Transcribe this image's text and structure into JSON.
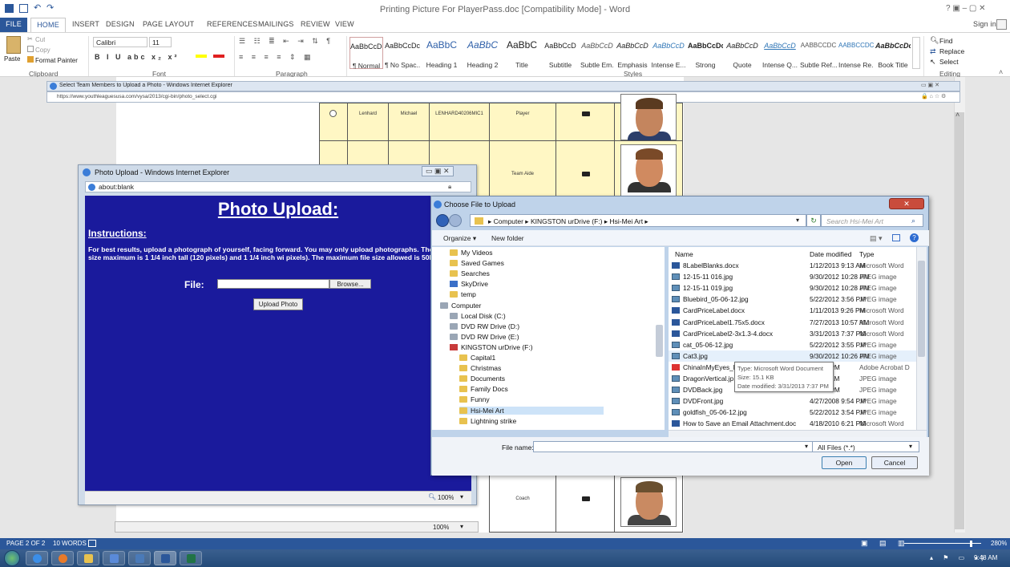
{
  "word": {
    "title": "Printing Picture For PlayerPass.doc [Compatibility Mode] - Word",
    "window_controls": "?   ▣  –  ▢  ✕",
    "sign_in": "Sign in",
    "tabs": [
      "FILE",
      "HOME",
      "INSERT",
      "DESIGN",
      "PAGE LAYOUT",
      "REFERENCES",
      "MAILINGS",
      "REVIEW",
      "VIEW"
    ],
    "clipboard": {
      "paste": "Paste",
      "cut": "Cut",
      "copy": "Copy",
      "format_painter": "Format Painter",
      "group": "Clipboard"
    },
    "font": {
      "name": "Calibri",
      "size": "11",
      "group": "Font"
    },
    "paragraph_group": "Paragraph",
    "styles_group": "Styles",
    "editing": {
      "find": "Find",
      "replace": "Replace",
      "select": "Select",
      "group": "Editing"
    },
    "styles": [
      {
        "sample": "AaBbCcDc",
        "name": "¶ Normal"
      },
      {
        "sample": "AaBbCcDc",
        "name": "¶ No Spac..."
      },
      {
        "sample": "AaBbC",
        "name": "Heading 1"
      },
      {
        "sample": "AaBbC",
        "name": "Heading 2"
      },
      {
        "sample": "AaBbC",
        "name": "Title"
      },
      {
        "sample": "AaBbCcD",
        "name": "Subtitle"
      },
      {
        "sample": "AaBbCcD",
        "name": "Subtle Em..."
      },
      {
        "sample": "AaBbCcD",
        "name": "Emphasis"
      },
      {
        "sample": "AaBbCcD",
        "name": "Intense E..."
      },
      {
        "sample": "AaBbCcDc",
        "name": "Strong"
      },
      {
        "sample": "AaBbCcD",
        "name": "Quote"
      },
      {
        "sample": "AaBbCcD",
        "name": "Intense Q..."
      },
      {
        "sample": "AABBCCDC",
        "name": "Subtle Ref..."
      },
      {
        "sample": "AABBCCDC",
        "name": "Intense Re..."
      },
      {
        "sample": "AaBbCcDc",
        "name": "Book Title"
      }
    ],
    "status": {
      "page": "PAGE 2 OF 2",
      "words": "10 WORDS",
      "zoom": "280%"
    }
  },
  "ie_background": {
    "title": "Select Team Members to Upload a Photo - Windows Internet Explorer",
    "url": "https://www.youthleaguesusa.com/vysa/2013/cgi-bin/photo_select.cgi"
  },
  "team_table": {
    "rows": [
      {
        "last": "Lenhard",
        "first": "Michael",
        "id": "LENHARD40206MIC1",
        "role": "Player"
      },
      {
        "last": "",
        "first": "",
        "id": "",
        "role": "Team Aide"
      },
      {
        "last": "",
        "first": "",
        "id": "",
        "role": "Coach"
      }
    ]
  },
  "photo_upload": {
    "window_title": "Photo Upload - Windows Internet Explorer",
    "address": "about:blank",
    "heading": "Photo Upload:",
    "instructions_heading": "Instructions:",
    "instructions": "For best results, upload a photograph of yourself, facing forward. You may only upload photographs. The photo size maximum is 1 1/4 inch tall (120 pixels) and 1 1/4 inch wi pixels). The maximum file size allowed is 50KB.",
    "file_label": "File:",
    "browse_label": "Browse...",
    "upload_label": "Upload Photo",
    "zoom": "100%"
  },
  "ie2_zoom": "100%",
  "choose_file": {
    "title": "Choose File to Upload",
    "breadcrumb": "▸ Computer ▸ KINGSTON urDrive (F:) ▸ Hsi-Mei Art ▸",
    "search_placeholder": "Search Hsi-Mei Art",
    "organize": "Organize ▾",
    "new_folder": "New folder",
    "columns": {
      "name": "Name",
      "date": "Date modified",
      "type": "Type"
    },
    "tree": [
      {
        "label": "My Videos",
        "kind": "folder",
        "indent": 1
      },
      {
        "label": "Saved Games",
        "kind": "folder",
        "indent": 1
      },
      {
        "label": "Searches",
        "kind": "folder",
        "indent": 1
      },
      {
        "label": "SkyDrive",
        "kind": "blue",
        "indent": 1
      },
      {
        "label": "temp",
        "kind": "folder",
        "indent": 1
      },
      {
        "label": "Computer",
        "kind": "drive",
        "indent": 0
      },
      {
        "label": "Local Disk (C:)",
        "kind": "drive",
        "indent": 1
      },
      {
        "label": "DVD RW Drive (D:)",
        "kind": "drive",
        "indent": 1
      },
      {
        "label": "DVD RW Drive (E:)",
        "kind": "drive",
        "indent": 1
      },
      {
        "label": "KINGSTON urDrive (F:)",
        "kind": "red",
        "indent": 1
      },
      {
        "label": "Capital1",
        "kind": "folder",
        "indent": 2
      },
      {
        "label": "Christmas",
        "kind": "folder",
        "indent": 2
      },
      {
        "label": "Documents",
        "kind": "folder",
        "indent": 2
      },
      {
        "label": "Family Docs",
        "kind": "folder",
        "indent": 2
      },
      {
        "label": "Funny",
        "kind": "folder",
        "indent": 2
      },
      {
        "label": "Hsi-Mei Art",
        "kind": "folder",
        "indent": 2,
        "selected": true
      },
      {
        "label": "Lightning strike",
        "kind": "folder",
        "indent": 2
      }
    ],
    "files": [
      {
        "name": "8LabelBlanks.docx",
        "date": "1/12/2013 9:13 AM",
        "type": "Microsoft Word",
        "icon": "word"
      },
      {
        "name": "12-15-11 016.jpg",
        "date": "9/30/2012 10:28 PM",
        "type": "JPEG image",
        "icon": "img"
      },
      {
        "name": "12-15-11 019.jpg",
        "date": "9/30/2012 10:28 PM",
        "type": "JPEG image",
        "icon": "img"
      },
      {
        "name": "Bluebird_05-06-12.jpg",
        "date": "5/22/2012 3:56 PM",
        "type": "JPEG image",
        "icon": "img"
      },
      {
        "name": "CardPriceLabel.docx",
        "date": "1/11/2013 9:26 PM",
        "type": "Microsoft Word",
        "icon": "word"
      },
      {
        "name": "CardPriceLabel1.75x5.docx",
        "date": "7/27/2013 10:57 AM",
        "type": "Microsoft Word",
        "icon": "word"
      },
      {
        "name": "CardPriceLabel2-3x1.3-4.docx",
        "date": "3/31/2013 7:37 PM",
        "type": "Microsoft Word",
        "icon": "word"
      },
      {
        "name": "cat_05-06-12.jpg",
        "date": "5/22/2012 3:55 PM",
        "type": "JPEG image",
        "icon": "img"
      },
      {
        "name": "Cat3.jpg",
        "date": "9/30/2012 10:26 PM",
        "type": "JPEG image",
        "icon": "img"
      },
      {
        "name": "ChinaInMyEyes_l...",
        "date": "3 1:21 PM",
        "type": "Adobe Acrobat D",
        "icon": "pdf"
      },
      {
        "name": "DragonVertical.jp",
        "date": "2 2:33 AM",
        "type": "JPEG image",
        "icon": "img"
      },
      {
        "name": "DVDBack.jpg",
        "date": "8 9:54 PM",
        "type": "JPEG image",
        "icon": "img"
      },
      {
        "name": "DVDFront.jpg",
        "date": "4/27/2008 9:54 PM",
        "type": "JPEG image",
        "icon": "img"
      },
      {
        "name": "goldfish_05-06-12.jpg",
        "date": "5/22/2012 3:54 PM",
        "type": "JPEG image",
        "icon": "img"
      },
      {
        "name": "How to Save an Email Attachment.doc",
        "date": "4/18/2010 6:21 PM",
        "type": "Microsoft Word",
        "icon": "word"
      }
    ],
    "tooltip": {
      "type": "Type: Microsoft Word Document",
      "size": "Size: 15.1 KB",
      "date": "Date modified: 3/31/2013 7:37 PM"
    },
    "file_name_label": "File name:",
    "file_name_value": "",
    "filter": "All Files (*.*)",
    "open": "Open",
    "cancel": "Cancel"
  },
  "taskbar": {
    "clock": "9:48 AM"
  }
}
